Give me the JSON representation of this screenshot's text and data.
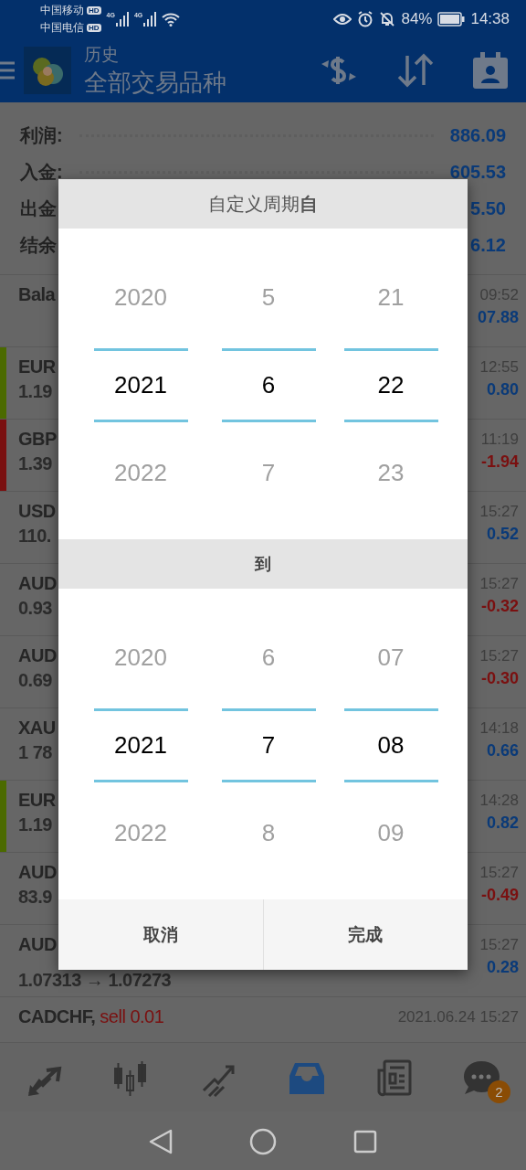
{
  "status_bar": {
    "carriers": [
      {
        "name": "中国移动",
        "badge": "HD",
        "network": "4G"
      },
      {
        "name": "中国电信",
        "badge": "HD",
        "network": "4G"
      }
    ],
    "battery": "84%",
    "time": "14:38"
  },
  "header": {
    "title": "历史",
    "subtitle": "全部交易品种"
  },
  "summary": [
    {
      "label": "利润:",
      "value": "886.09"
    },
    {
      "label": "入金:",
      "value": "605.53"
    },
    {
      "label": "出金",
      "value": "5.50"
    },
    {
      "label": "结余",
      "value": "6.12"
    }
  ],
  "deals": [
    {
      "symbol": "Bala",
      "time": "09:52",
      "profit": "07.88",
      "loss": false
    },
    {
      "symbol": "EUR",
      "price": "1.19",
      "time": "12:55",
      "profit": "0.80",
      "loss": false,
      "color": "#4b6a00"
    },
    {
      "symbol": "GBP",
      "price": "1.39",
      "time": "11:19",
      "profit": "-1.94",
      "loss": true,
      "color": "#7a1010"
    },
    {
      "symbol": "USD",
      "price": "110.",
      "time": "15:27",
      "profit": "0.52",
      "loss": false
    },
    {
      "symbol": "AUD",
      "price": "0.93",
      "time": "15:27",
      "profit": "-0.32",
      "loss": true
    },
    {
      "symbol": "AUD",
      "price": "0.69",
      "time": "15:27",
      "profit": "-0.30",
      "loss": true
    },
    {
      "symbol": "XAU",
      "price": "1 78",
      "time": "14:18",
      "profit": "0.66",
      "loss": false
    },
    {
      "symbol": "EUR",
      "price": "1.19",
      "time": "14:28",
      "profit": "0.82",
      "loss": false,
      "color": "#4b6a00"
    },
    {
      "symbol": "AUD",
      "price": "83.9",
      "time": "15:27",
      "profit": "-0.49",
      "loss": true
    },
    {
      "symbol": "AUD",
      "price": "1.07313 → 1.07273",
      "time": "15:27",
      "profit": "0.28",
      "loss": false
    },
    {
      "symbol": "CADCHF,",
      "order": "sell 0.01",
      "time": "2021.06.24 15:27"
    }
  ],
  "dialog": {
    "title": "自定义周期**自**",
    "from": [
      [
        {
          "text": "2020",
          "selected": false
        },
        {
          "text": "2021",
          "selected": true
        },
        {
          "text": "2022",
          "selected": false
        }
      ],
      [
        {
          "text": "5",
          "selected": false
        },
        {
          "text": "6",
          "selected": true
        },
        {
          "text": "7",
          "selected": false
        }
      ],
      [
        {
          "text": "21",
          "selected": false
        },
        {
          "text": "22",
          "selected": true
        },
        {
          "text": "23",
          "selected": false
        }
      ]
    ],
    "to_label": "到",
    "to": [
      [
        {
          "text": "2020",
          "selected": false
        },
        {
          "text": "2021",
          "selected": true
        },
        {
          "text": "2022",
          "selected": false
        }
      ],
      [
        {
          "text": "6",
          "selected": false
        },
        {
          "text": "7",
          "selected": true
        },
        {
          "text": "8",
          "selected": false
        }
      ],
      [
        {
          "text": "07",
          "selected": false
        },
        {
          "text": "08",
          "selected": true
        },
        {
          "text": "09",
          "selected": false
        }
      ]
    ],
    "buttons": [
      "取消",
      "完成"
    ]
  },
  "bottom_nav": [
    {
      "kind": "quotes",
      "selected": false
    },
    {
      "kind": "charts",
      "selected": false
    },
    {
      "kind": "trade",
      "selected": false
    },
    {
      "kind": "history",
      "selected": true
    },
    {
      "kind": "news",
      "selected": false
    },
    {
      "kind": "chat",
      "selected": false,
      "badge": "2"
    }
  ]
}
